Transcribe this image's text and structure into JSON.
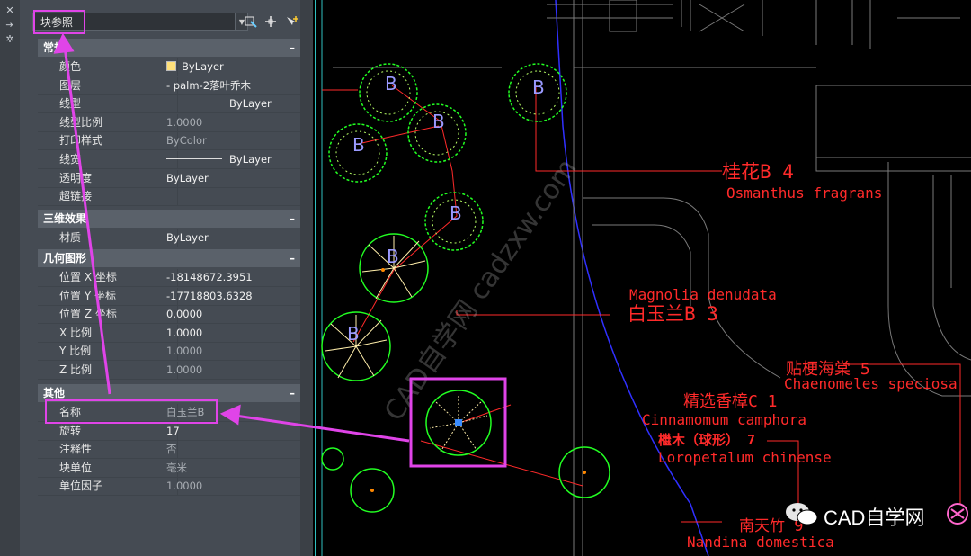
{
  "panel": {
    "selector_value": "块参照",
    "toolbar_icons": [
      "quick-select-icon",
      "select-objects-icon",
      "pickadd-toggle-icon"
    ],
    "strip_icons": [
      "close-icon",
      "autohide-icon",
      "settings-icon"
    ]
  },
  "sections": [
    {
      "title": "常规",
      "collapse": "–",
      "rows": [
        {
          "label": "颜色",
          "value": "ByLayer",
          "kind": "swatch"
        },
        {
          "label": "图层",
          "value": "- palm-2落叶乔木"
        },
        {
          "label": "线型",
          "value": "ByLayer",
          "kind": "line"
        },
        {
          "label": "线型比例",
          "value": "1.0000",
          "dim": true
        },
        {
          "label": "打印样式",
          "value": "ByColor",
          "dim": true
        },
        {
          "label": "线宽",
          "value": "ByLayer",
          "kind": "line"
        },
        {
          "label": "透明度",
          "value": "ByLayer"
        },
        {
          "label": "超链接",
          "value": ""
        }
      ]
    },
    {
      "title": "三维效果",
      "collapse": "–",
      "rows": [
        {
          "label": "材质",
          "value": "ByLayer"
        }
      ]
    },
    {
      "title": "几何图形",
      "collapse": "–",
      "rows": [
        {
          "label": "位置 X 坐标",
          "value": "-18148672.3951"
        },
        {
          "label": "位置 Y 坐标",
          "value": "-17718803.6328"
        },
        {
          "label": "位置 Z 坐标",
          "value": "0.0000"
        },
        {
          "label": "X 比例",
          "value": "1.0000"
        },
        {
          "label": "Y 比例",
          "value": "1.0000",
          "dim": true
        },
        {
          "label": "Z 比例",
          "value": "1.0000",
          "dim": true
        }
      ]
    },
    {
      "title": "其他",
      "collapse": "–",
      "rows": [
        {
          "label": "名称",
          "value": "白玉兰B",
          "dim": true
        },
        {
          "label": "旋转",
          "value": "17"
        },
        {
          "label": "注释性",
          "value": "否",
          "dim": true
        },
        {
          "label": "块单位",
          "value": "毫米",
          "dim": true
        },
        {
          "label": "单位因子",
          "value": "1.0000",
          "dim": true
        }
      ]
    }
  ],
  "cad": {
    "tree_letters": [
      "B",
      "B",
      "B",
      "B",
      "B",
      "B",
      "B"
    ],
    "labels": {
      "osmanthus_cn": "桂花B 4",
      "osmanthus_en": "Osmanthus fragrans",
      "magnolia_en": "Magnolia denudata",
      "magnolia_cn": "白玉兰B 3",
      "chaenomeles_cn": "贴梗海棠 5",
      "chaenomeles_en": "Chaenomeles speciosa",
      "camphor_cn": "精选香樟C 1",
      "camphor_en": "Cinnamomum camphora",
      "loropetalum_cn": "檵木（球形） 7",
      "loropetalum_en": "Loropetalum chinense",
      "nandina_cn": "南天竹 9",
      "nandina_en": "Nandina domestica"
    },
    "watermark_diag": "CAD自学网 cadzxw.com"
  },
  "watermark": {
    "text": "CAD自学网"
  },
  "colors": {
    "panel": "#454b53",
    "highlight": "#e044e8",
    "cad_red": "#ff2a2a",
    "cad_green": "#22ff22"
  }
}
